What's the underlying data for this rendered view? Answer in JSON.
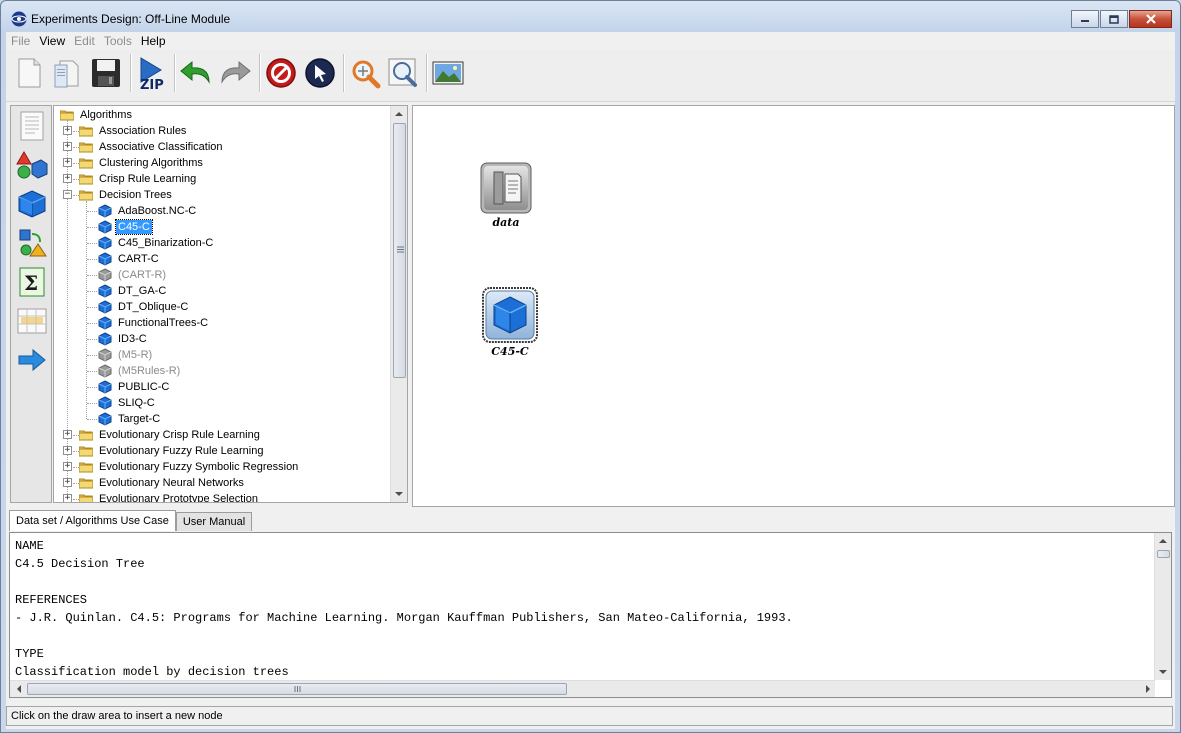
{
  "window": {
    "title": "Experiments Design: Off-Line Module"
  },
  "menu": [
    {
      "label": "File",
      "enabled": false
    },
    {
      "label": "View",
      "enabled": true
    },
    {
      "label": "Edit",
      "enabled": false
    },
    {
      "label": "Tools",
      "enabled": false
    },
    {
      "label": "Help",
      "enabled": true
    }
  ],
  "toolbar": {
    "buttons": [
      {
        "name": "new-icon"
      },
      {
        "name": "open-icon"
      },
      {
        "name": "save-icon"
      },
      {
        "name": "zip-icon",
        "text": "ZIP"
      },
      {
        "name": "undo-icon"
      },
      {
        "name": "redo-icon"
      },
      {
        "name": "stop-icon"
      },
      {
        "name": "pointer-icon"
      },
      {
        "name": "zoom-icon"
      },
      {
        "name": "zoom-fit-icon"
      },
      {
        "name": "image-icon"
      }
    ]
  },
  "sidebar": {
    "buttons": [
      "document-icon",
      "shapes-icon",
      "cube-icon",
      "cubes-exchange-icon",
      "sigma-icon",
      "table-icon",
      "arrow-right-icon"
    ]
  },
  "tree": {
    "root": "Algorithms",
    "items": [
      {
        "label": "Association Rules",
        "type": "folder"
      },
      {
        "label": "Associative Classification",
        "type": "folder"
      },
      {
        "label": "Clustering Algorithms",
        "type": "folder"
      },
      {
        "label": "Crisp Rule Learning",
        "type": "folder"
      },
      {
        "label": "Decision Trees",
        "type": "folder",
        "expanded": true
      },
      {
        "label": "AdaBoost.NC-C",
        "type": "algo"
      },
      {
        "label": "C45-C",
        "type": "algo",
        "selected": true
      },
      {
        "label": "C45_Binarization-C",
        "type": "algo"
      },
      {
        "label": "CART-C",
        "type": "algo"
      },
      {
        "label": "(CART-R)",
        "type": "algo",
        "disabled": true
      },
      {
        "label": "DT_GA-C",
        "type": "algo"
      },
      {
        "label": "DT_Oblique-C",
        "type": "algo"
      },
      {
        "label": "FunctionalTrees-C",
        "type": "algo"
      },
      {
        "label": "ID3-C",
        "type": "algo"
      },
      {
        "label": "(M5-R)",
        "type": "algo",
        "disabled": true
      },
      {
        "label": "(M5Rules-R)",
        "type": "algo",
        "disabled": true
      },
      {
        "label": "PUBLIC-C",
        "type": "algo"
      },
      {
        "label": "SLIQ-C",
        "type": "algo"
      },
      {
        "label": "Target-C",
        "type": "algo"
      },
      {
        "label": "Evolutionary Crisp Rule Learning",
        "type": "folder"
      },
      {
        "label": "Evolutionary Fuzzy Rule Learning",
        "type": "folder"
      },
      {
        "label": "Evolutionary Fuzzy Symbolic Regression",
        "type": "folder"
      },
      {
        "label": "Evolutionary Neural Networks",
        "type": "folder"
      },
      {
        "label": "Evolutionary Prototype Selection",
        "type": "folder"
      }
    ]
  },
  "canvas": {
    "nodes": [
      {
        "label": "data",
        "icon": "dataset-icon"
      },
      {
        "label": "C45-C",
        "icon": "algorithm-cube-icon"
      }
    ]
  },
  "tabs": [
    {
      "label": "Data set / Algorithms Use Case",
      "active": true
    },
    {
      "label": "User Manual",
      "active": false
    }
  ],
  "description": {
    "lines": [
      "NAME",
      "C4.5 Decision Tree",
      "",
      "REFERENCES",
      "- J.R. Quinlan. C4.5: Programs for Machine Learning. Morgan Kauffman Publishers, San Mateo-California, 1993.",
      "",
      "TYPE",
      "Classification model by decision trees"
    ]
  },
  "status": {
    "text": "Click on the draw area to insert a new node"
  }
}
